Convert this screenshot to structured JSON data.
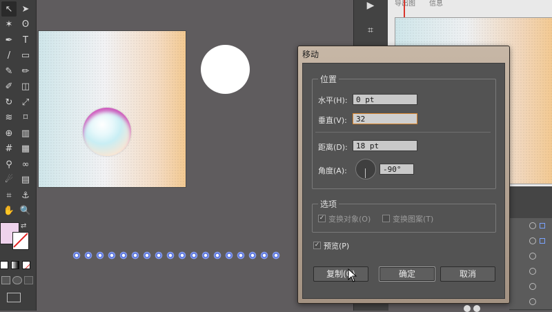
{
  "toolbar": {
    "tools": [
      {
        "name": "direct-selection-icon",
        "glyph": "↖"
      },
      {
        "name": "selection-icon",
        "glyph": "➤"
      },
      {
        "name": "magic-wand-icon",
        "glyph": "✶"
      },
      {
        "name": "lasso-icon",
        "glyph": "ʘ"
      },
      {
        "name": "pen-icon",
        "glyph": "✒"
      },
      {
        "name": "type-icon",
        "glyph": "T"
      },
      {
        "name": "line-icon",
        "glyph": "/"
      },
      {
        "name": "rectangle-icon",
        "glyph": "▭"
      },
      {
        "name": "paintbrush-icon",
        "glyph": "✎"
      },
      {
        "name": "pencil-icon",
        "glyph": "✏"
      },
      {
        "name": "blob-brush-icon",
        "glyph": "✐"
      },
      {
        "name": "eraser-icon",
        "glyph": "◫"
      },
      {
        "name": "rotate-icon",
        "glyph": "↻"
      },
      {
        "name": "scale-icon",
        "glyph": "⤢"
      },
      {
        "name": "width-icon",
        "glyph": "≋"
      },
      {
        "name": "free-transform-icon",
        "glyph": "⌑"
      },
      {
        "name": "shape-builder-icon",
        "glyph": "⊕"
      },
      {
        "name": "graph-icon",
        "glyph": "▥"
      },
      {
        "name": "mesh-icon",
        "glyph": "#"
      },
      {
        "name": "gradient-icon",
        "glyph": "▦"
      },
      {
        "name": "eyedropper-icon",
        "glyph": "⚲"
      },
      {
        "name": "blend-icon",
        "glyph": "∞"
      },
      {
        "name": "symbol-sprayer-icon",
        "glyph": "☄"
      },
      {
        "name": "column-graph-icon",
        "glyph": "▤"
      },
      {
        "name": "artboard-icon",
        "glyph": "⌗"
      },
      {
        "name": "slice-icon",
        "glyph": "⚓"
      },
      {
        "name": "hand-icon",
        "glyph": "✋"
      },
      {
        "name": "zoom-icon",
        "glyph": "🔍"
      }
    ]
  },
  "dialog": {
    "title": "移动",
    "position_group": "位置",
    "horizontal_label": "水平(H):",
    "horizontal_value": "0 pt",
    "vertical_label": "垂直(V):",
    "vertical_value": "32",
    "distance_label": "距离(D):",
    "distance_value": "18 pt",
    "angle_label": "角度(A):",
    "angle_value": "-90°",
    "options_group": "选项",
    "transform_objects_label": "变换对象(O)",
    "transform_patterns_label": "变换图案(T)",
    "preview_label": "预览(P)",
    "copy_button": "复制(C)",
    "ok_button": "确定",
    "cancel_button": "取消"
  },
  "right_panel": {
    "tab_labels": [
      "导出图",
      "信息"
    ]
  },
  "colors": {
    "fill": "#efd3ec",
    "stroke": "#ffffff",
    "accent_focus": "#d9862d"
  }
}
